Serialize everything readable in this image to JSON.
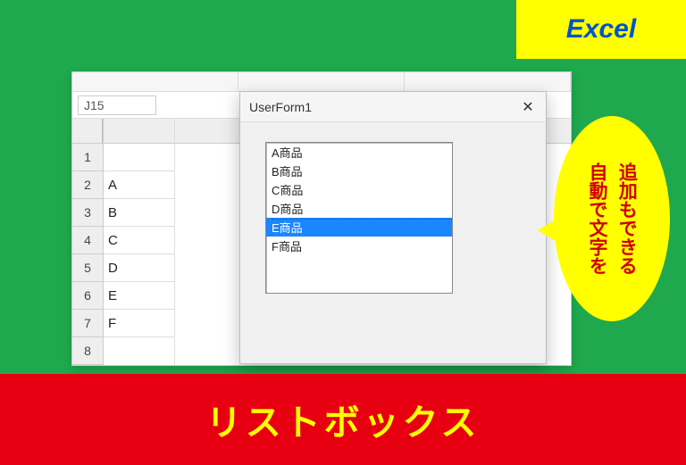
{
  "badge": {
    "label": "Excel"
  },
  "excel": {
    "name_box": "J15",
    "col_header": "",
    "rows": [
      "1",
      "2",
      "3",
      "4",
      "5",
      "6",
      "7",
      "8"
    ],
    "col_a_cells": [
      "",
      "A",
      "B",
      "C",
      "D",
      "E",
      "F",
      ""
    ]
  },
  "userform": {
    "title": "UserForm1",
    "listbox_items": [
      "A商品",
      "B商品",
      "C商品",
      "D商品",
      "E商品",
      "F商品"
    ],
    "selected_index": 4
  },
  "bubble": {
    "line1": "自動で文字を",
    "line2": "追加もできる"
  },
  "bottom": {
    "title": "リストボックス"
  }
}
